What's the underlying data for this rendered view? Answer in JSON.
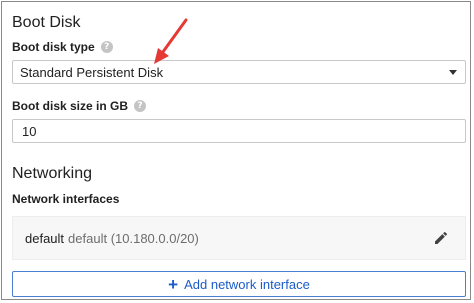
{
  "boot_disk": {
    "title": "Boot Disk",
    "type_label": "Boot disk type",
    "type_value": "Standard Persistent Disk",
    "size_label": "Boot disk size in GB",
    "size_value": "10"
  },
  "networking": {
    "title": "Networking",
    "interfaces_label": "Network interfaces",
    "interfaces": [
      {
        "name": "default",
        "detail": "default (10.180.0.0/20)"
      }
    ],
    "add_button_label": "Add network interface"
  },
  "icons": {
    "help": "help-icon",
    "dropdown": "chevron-down-icon",
    "edit": "pencil-icon",
    "add": "plus-icon",
    "annotation": "red-arrow"
  },
  "colors": {
    "accent": "#1a5cc8",
    "annotation_arrow": "#e53935"
  }
}
